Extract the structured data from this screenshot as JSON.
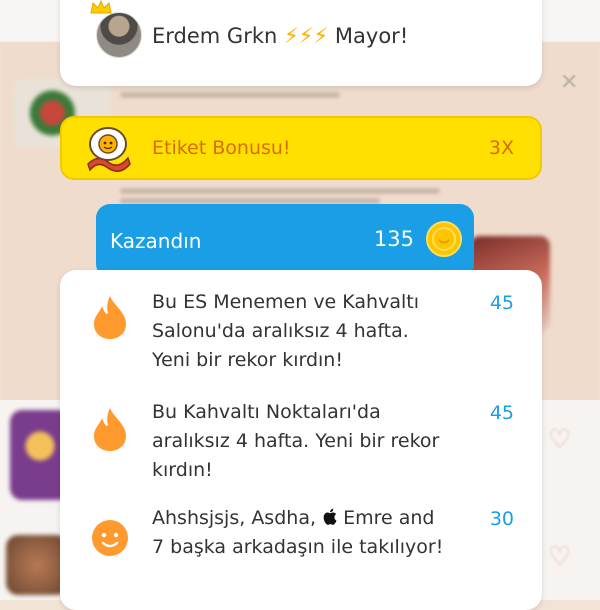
{
  "mayor": {
    "name": "Erdem Grkn",
    "bolts": "⚡⚡⚡",
    "title": "Mayor!"
  },
  "bonus": {
    "label": "Etiket Bonusu!",
    "multiplier": "3X"
  },
  "earned": {
    "label": "Kazandın",
    "points": "135"
  },
  "rewards": [
    {
      "icon": "flame-icon",
      "text": "Bu ES Menemen ve Kahvaltı Salonu'da aralıksız 4 hafta. Yeni bir rekor kırdın!",
      "points": "45"
    },
    {
      "icon": "flame-icon",
      "text": "Bu Kahvaltı Noktaları'da aralıksız 4 hafta. Yeni bir rekor kırdın!",
      "points": "45"
    },
    {
      "icon": "smiley-icon",
      "text_before": "Ahshsjsjs, Asdha,",
      "text_after": "Emre and 7 başka arkadaşın ile takılıyor!",
      "points": "30"
    }
  ],
  "colors": {
    "accent_blue": "#1a9fe6",
    "bonus_yellow": "#ffe000",
    "bonus_text": "#d86e00",
    "flame_orange": "#ff9a2e"
  }
}
